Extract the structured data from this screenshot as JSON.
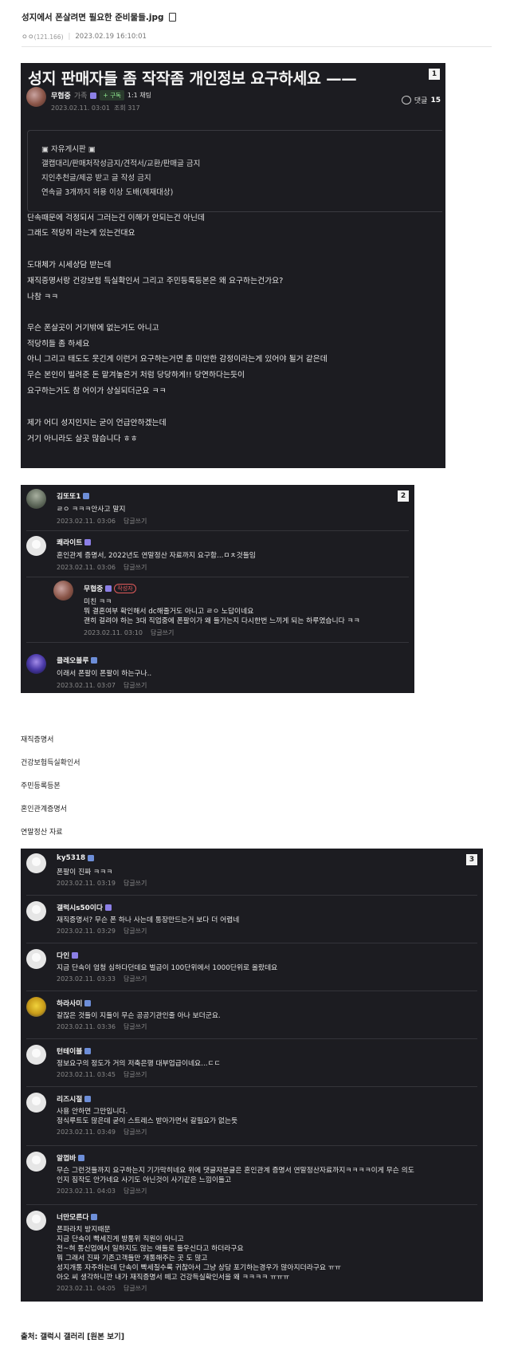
{
  "header": {
    "title": "성지에서 폰살려면 필요한 준비물들.jpg",
    "author": "ㅇㅇ",
    "author_id": "(121.166)",
    "datetime": "2023.02.19 16:10:01"
  },
  "post": {
    "badge": "1",
    "title": "성지 판매자들 좀 작작좀 개인정보 요구하세요 ——",
    "author": "무협중",
    "family": "가족",
    "subscribe": "+ 구독",
    "chat": "1:1 채팅",
    "date": "2023.02.11. 03:01",
    "views": "조회 317",
    "comment_label": "댓글",
    "comment_count": "15",
    "rules": [
      "▣ 자유게시판 ▣",
      "갤캡대리/판매처작성금지/견적서/교환/판매글 금지",
      "지인추천글/제공 받고 글 작성 금지",
      "연속글 3개까지 허용 이상 도배(제재대상)"
    ],
    "body": [
      "단속때문에 걱정되서 그러는건 이해가 안되는건 아닌데",
      "그래도 적당히 라는게 있는건대요",
      "도대체가 시세상담 받는데",
      "재직증명서랑 건강보험 득실확인서 그리고 주민등록등본은 왜 요구하는건가요?",
      "나참 ㅋㅋ",
      "무슨 폰살곳이 거기밖에 없는거도 아니고",
      "적당히들 좀 하세요",
      "아니 그리고 태도도 웃긴게 이런거 요구하는거면 좀 미안한 감정이라는게 있어야 될거 같은데",
      "무슨 본인이 빌려준 돈 맡겨놓은거 처럼 당당하게!! 당연하다는듯이",
      "요구하는거도 참 어이가 상실되더군요 ㅋㅋ",
      "제가 어디 성지인지는 굳이 언급안하겠는데",
      "거기 아니라도 살곳 많습니다 ㅎㅎ"
    ]
  },
  "comments1": {
    "badge": "2",
    "reply_label": "답글쓰기",
    "author_tag": "작성자",
    "items": [
      {
        "name": "김또또1",
        "text": "ㄹㅇ ㅋㅋㅋ안사고 말지",
        "date": "2023.02.11. 03:06"
      },
      {
        "name": "쾌라이트",
        "text": "혼인관계 증명서, 2022년도 연말정산 자료까지 요구함...ㅁㅊ것들임",
        "date": "2023.02.11. 03:06"
      },
      {
        "name": "무협중",
        "lines": [
          "미친 ㅋㅋ",
          "뭐 결혼여부 확인해서 dc해줄거도 아니고 ㄹㅇ 노답이네요",
          "괜히 걸려야 하는 3대 직업중에 폰팔이가 왜 들가는지 다시한번 느끼게 되는 하루였습니다 ㅋㅋ"
        ],
        "date": "2023.02.11. 03:10"
      },
      {
        "name": "클레오블루",
        "text": "이래서 폰팔이 폰팔이 하는구나..",
        "date": "2023.02.11. 03:07"
      }
    ]
  },
  "doc_list": [
    "재직증명서",
    "건강보험득실확인서",
    "주민등록등본",
    "혼인관계증명서",
    "연말정산 자료"
  ],
  "comments2": {
    "badge": "3",
    "reply_label": "답글쓰기",
    "items": [
      {
        "name": "ky5318",
        "lines": [
          "폰팔이 진짜 ㅋㅋㅋ"
        ],
        "date": "2023.02.11. 03:19"
      },
      {
        "name": "갤럭시s50이다",
        "lines": [
          "재직증명서? 무슨 폰 하나 사는데 통장만드는거 보다 더 어렵네"
        ],
        "date": "2023.02.11. 03:29"
      },
      {
        "name": "다인",
        "lines": [
          "지금 단속이 엄청 심하다던데요 벌금이 100단위에서 1000단위로 올랐데요"
        ],
        "date": "2023.02.11. 03:33"
      },
      {
        "name": "하라사미",
        "lines": [
          "갈잖은 것들이 지들이 무슨 공공기관인줄 아나 보더군요."
        ],
        "date": "2023.02.11. 03:36"
      },
      {
        "name": "턴테이블",
        "lines": [
          "정보요구의 정도가 거의 저축은행 대부업급이네요...ㄷㄷ"
        ],
        "date": "2023.02.11. 03:45"
      },
      {
        "name": "리즈시절",
        "lines": [
          "사용 안하면 그만입니다.",
          "정식루트도 많은데 굳이 스트레스 받아가면서 갈필요가 없는듯"
        ],
        "date": "2023.02.11. 03:49"
      },
      {
        "name": "알껍바",
        "lines": [
          "무슨 그런것들까지 요구하는지 기가막히네요 위에 댓글자분글은 혼인관계 증명서 연말정산자료까지ㅋㅋㅋㅋ이게 무슨 의도",
          "인지 짐작도 안가네요 사기도 아닌것이 사기같은 느낌이들고"
        ],
        "date": "2023.02.11. 04:03"
      },
      {
        "name": "너만모른다",
        "lines": [
          "폰파라치 방지때문",
          "지금 단속이 빡세진게 방통위 직원이 아니고",
          "전~혀 통신업에서 일하지도 않는 애들로 들우신다고 하더라구요",
          "뭐 그래서 진짜 기존고객들만 개통해주는 곳 도 많고",
          "성지개통 자주하는데 단속이 빡세질수록 귀찮아서 그냥 상담 포기하는경우가 많아지더라구요 ㅠㅠ",
          "아오 씨 생각하니깐 내가 재직증명서 떼고 건강득실확인서을 왜 ㅋㅋㅋㅋ ㅠㅠㅠ"
        ],
        "date": "2023.02.11. 04:05"
      }
    ]
  },
  "source": {
    "label": "출처:",
    "gallery": "갤럭시 갤러리",
    "link": "[원본 보기]"
  }
}
